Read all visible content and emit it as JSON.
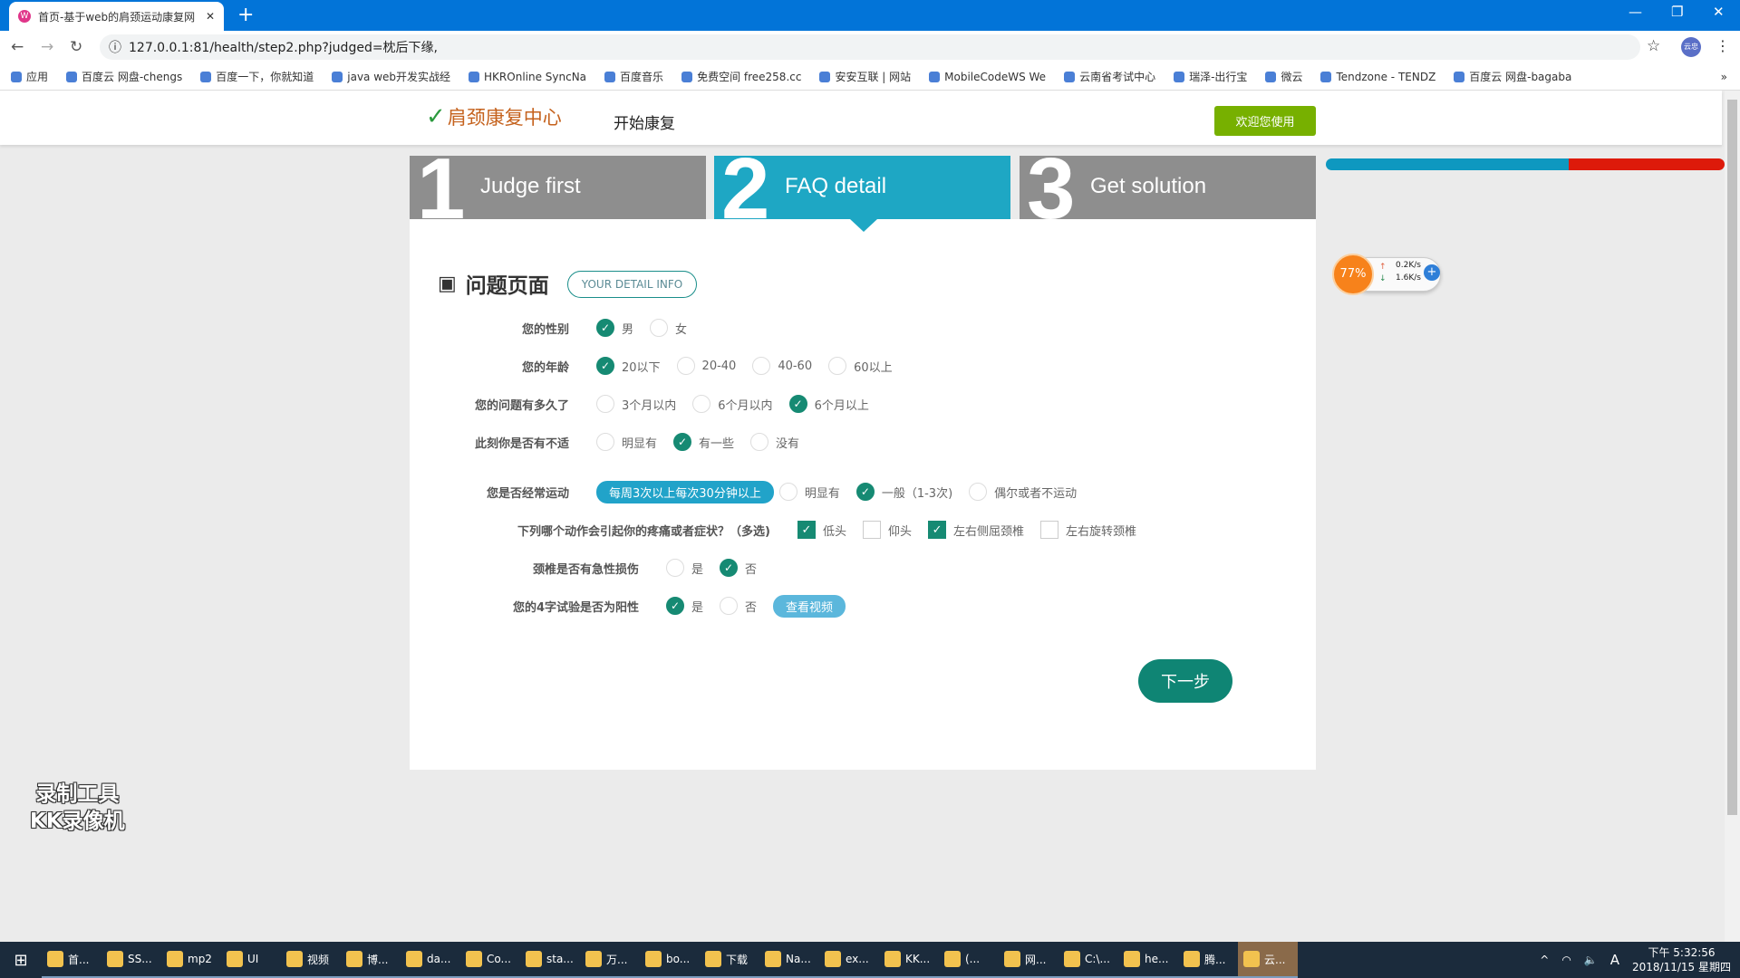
{
  "browser": {
    "tab_title": "首页-基于web的肩颈运动康复网",
    "url": "127.0.0.1:81/health/step2.php?judged=枕后下缘,",
    "bookmarks": [
      "应用",
      "百度云 网盘-chengs",
      "百度一下，你就知道",
      "java web开发实战经",
      "HKROnline SyncNa",
      "百度音乐",
      "免费空间 free258.cc",
      "安安互联 | 网站",
      "MobileCodeWS We",
      "云南省考试中心",
      "瑞泽-出行宝",
      "微云",
      "Tendzone - TENDZ",
      "百度云 网盘-bagaba"
    ],
    "profile": "云忠"
  },
  "header": {
    "logo_text": "肩颈康复中心",
    "nav_start": "开始康复",
    "welcome_button": "欢迎您使用"
  },
  "steps": [
    {
      "num": "1",
      "label": "Judge first"
    },
    {
      "num": "2",
      "label": "FAQ detail"
    },
    {
      "num": "3",
      "label": "Get solution"
    }
  ],
  "active_step": 2,
  "progress": {
    "percent": 61,
    "colors": {
      "done": "#0e98c0",
      "rest": "#dd1a0a"
    }
  },
  "net_widget": {
    "percent": "77%",
    "up": "0.2K/s",
    "down": "1.6K/s"
  },
  "form": {
    "title": "问题页面",
    "badge": "YOUR DETAIL INFO",
    "rows": [
      {
        "label": "您的性别",
        "options": [
          {
            "text": "男",
            "checked": true
          },
          {
            "text": "女",
            "checked": false
          }
        ]
      },
      {
        "label": "您的年龄",
        "options": [
          {
            "text": "20以下",
            "checked": true
          },
          {
            "text": "20-40",
            "checked": false
          },
          {
            "text": "40-60",
            "checked": false
          },
          {
            "text": "60以上",
            "checked": false
          }
        ]
      },
      {
        "label": "您的问题有多久了",
        "options": [
          {
            "text": "3个月以内",
            "checked": false
          },
          {
            "text": "6个月以内",
            "checked": false
          },
          {
            "text": "6个月以上",
            "checked": true
          }
        ]
      },
      {
        "label": "此刻你是否有不适",
        "options": [
          {
            "text": "明显有",
            "checked": false
          },
          {
            "text": "有一些",
            "checked": true
          },
          {
            "text": "没有",
            "checked": false
          }
        ]
      }
    ],
    "exercise": {
      "label": "您是否经常运动",
      "pill": "每周3次以上每次30分钟以上",
      "options": [
        {
          "text": "明显有",
          "checked": false
        },
        {
          "text": "一般（1-3次)",
          "checked": true
        },
        {
          "text": "偶尔或者不运动",
          "checked": false
        }
      ]
    },
    "actions": {
      "label": "下列哪个动作会引起你的疼痛或者症状？（多选)",
      "options": [
        {
          "text": "低头",
          "checked": true
        },
        {
          "text": "仰头",
          "checked": false
        },
        {
          "text": "左右侧屈颈椎",
          "checked": true
        },
        {
          "text": "左右旋转颈椎",
          "checked": false
        }
      ]
    },
    "injury": {
      "label": "颈椎是否有急性损伤",
      "options": [
        {
          "text": "是",
          "checked": false
        },
        {
          "text": "否",
          "checked": true
        }
      ]
    },
    "test4": {
      "label": "您的4字试验是否为阳性",
      "options": [
        {
          "text": "是",
          "checked": true
        },
        {
          "text": "否",
          "checked": false
        }
      ],
      "video_button": "查看视频"
    },
    "next_button": "下一步"
  },
  "watermark": {
    "line1": "录制工具",
    "line2": "KK录像机"
  },
  "taskbar": {
    "items": [
      "首...",
      "SS...",
      "mp2",
      "UI",
      "视频",
      "博...",
      "da...",
      "Co...",
      "sta...",
      "万...",
      "bo...",
      "下载",
      "Na...",
      "ex...",
      "KK...",
      "(...",
      "网...",
      "C:\\...",
      "he...",
      "腾...",
      "云..."
    ],
    "time": "下午 5:32:56",
    "date": "2018/11/15 星期四"
  },
  "accent": "#168a73"
}
